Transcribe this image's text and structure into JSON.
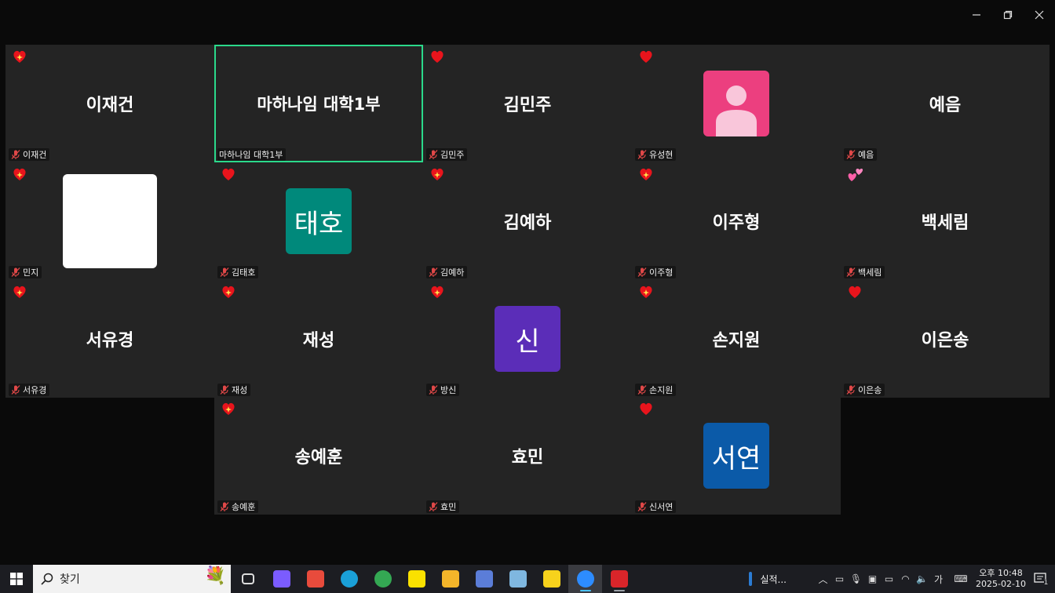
{
  "window": {
    "minimize_icon": "minimize-icon",
    "restore_icon": "restore-icon",
    "close_icon": "close-icon"
  },
  "tiles": [
    {
      "display": "이재건",
      "label": "이재건",
      "react": "heart-sparkle",
      "avatar": null
    },
    {
      "display": "마하나임 대학1부",
      "label": "마하나임 대학1부",
      "react": null,
      "avatar": null,
      "active": true
    },
    {
      "display": "김민주",
      "label": "김민주",
      "react": "heart",
      "avatar": null
    },
    {
      "display": "",
      "label": "유성현",
      "react": "heart",
      "avatar": {
        "type": "profile",
        "color": "#ec3f7f"
      }
    },
    {
      "display": "예음",
      "label": "예음",
      "react": null,
      "avatar": null
    },
    {
      "display": "",
      "label": "민지",
      "react": "heart-sparkle",
      "avatar": {
        "type": "blank",
        "color": "#ffffff"
      }
    },
    {
      "display": "",
      "label": "김태호",
      "react": "heart",
      "avatar": {
        "type": "text",
        "text": "태호",
        "color": "#00897b"
      }
    },
    {
      "display": "김예하",
      "label": "김예하",
      "react": "heart-sparkle",
      "avatar": null
    },
    {
      "display": "이주형",
      "label": "이주형",
      "react": "heart-sparkle",
      "avatar": null
    },
    {
      "display": "백세림",
      "label": "백세림",
      "react": "two-hearts",
      "avatar": null
    },
    {
      "display": "서유경",
      "label": "서유경",
      "react": "heart-sparkle",
      "avatar": null
    },
    {
      "display": "재성",
      "label": "재성",
      "react": "heart-sparkle",
      "avatar": null
    },
    {
      "display": "",
      "label": "방신",
      "react": "heart-sparkle",
      "avatar": {
        "type": "text",
        "text": "신",
        "color": "#5b2db8"
      }
    },
    {
      "display": "손지원",
      "label": "손지원",
      "react": "heart-sparkle",
      "avatar": null
    },
    {
      "display": "이은송",
      "label": "이은송",
      "react": "heart",
      "avatar": null
    },
    {
      "display": "송예훈",
      "label": "송예훈",
      "react": "heart-sparkle",
      "avatar": null
    },
    {
      "display": "효민",
      "label": "효민",
      "react": null,
      "avatar": null
    },
    {
      "display": "",
      "label": "신서연",
      "react": "heart",
      "avatar": {
        "type": "text",
        "text": "서연",
        "color": "#0b5aa8"
      }
    }
  ],
  "taskbar": {
    "search_label": "찾기",
    "apps": [
      {
        "name": "task-view",
        "color": "#1c1d22",
        "open": false
      },
      {
        "name": "copilot",
        "color": "#7b5cff",
        "open": false
      },
      {
        "name": "app-stack",
        "color": "#e84b3c",
        "open": false
      },
      {
        "name": "edge",
        "color": "#1aa0d8",
        "open": false
      },
      {
        "name": "chrome",
        "color": "#34a853",
        "open": false
      },
      {
        "name": "kakaotalk",
        "color": "#fae100",
        "open": false
      },
      {
        "name": "file-explorer",
        "color": "#f3b52a",
        "open": false
      },
      {
        "name": "calculator",
        "color": "#5b7dd8",
        "open": false
      },
      {
        "name": "notepad",
        "color": "#7fb7e0",
        "open": false
      },
      {
        "name": "sticky-notes",
        "color": "#f7d21c",
        "open": false
      },
      {
        "name": "zoom",
        "color": "#2d8cff",
        "open": true,
        "active": true
      },
      {
        "name": "pdf-reader",
        "color": "#d9252a",
        "open": true
      }
    ],
    "running_app_label": "실적...",
    "ime_label": "가",
    "clock_time": "오후 10:48",
    "clock_date": "2025-02-10",
    "notification_count": "1"
  }
}
